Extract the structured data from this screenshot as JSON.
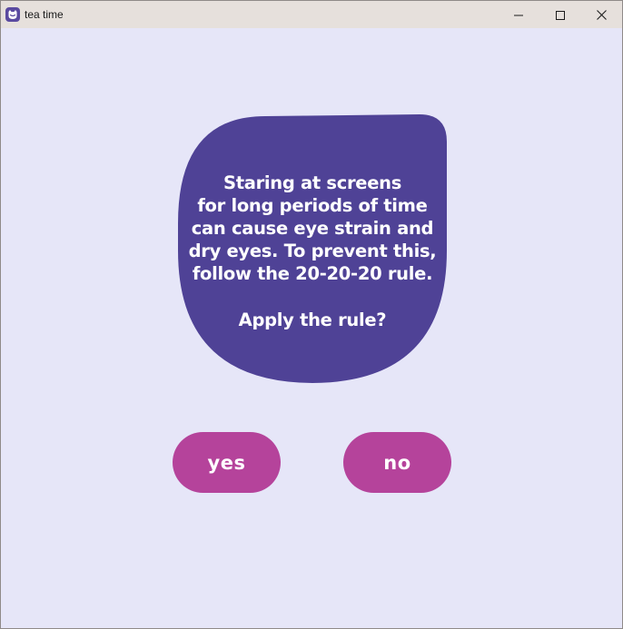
{
  "window": {
    "title": "tea time"
  },
  "dialog": {
    "message": "Staring at screens\nfor long periods of time\ncan cause eye strain and\ndry eyes. To prevent this,\nfollow the 20-20-20 rule.",
    "question": "Apply the rule?"
  },
  "buttons": {
    "yes_label": "yes",
    "no_label": "no"
  },
  "colors": {
    "background": "#e6e6f8",
    "blob": "#4f4296",
    "button": "#b5439b",
    "titlebar": "#e6e0dc",
    "app_icon": "#5a4aa0"
  },
  "icons": {
    "app": "cat-face-icon",
    "minimize": "minimize-icon",
    "maximize": "maximize-icon",
    "close": "close-icon"
  }
}
